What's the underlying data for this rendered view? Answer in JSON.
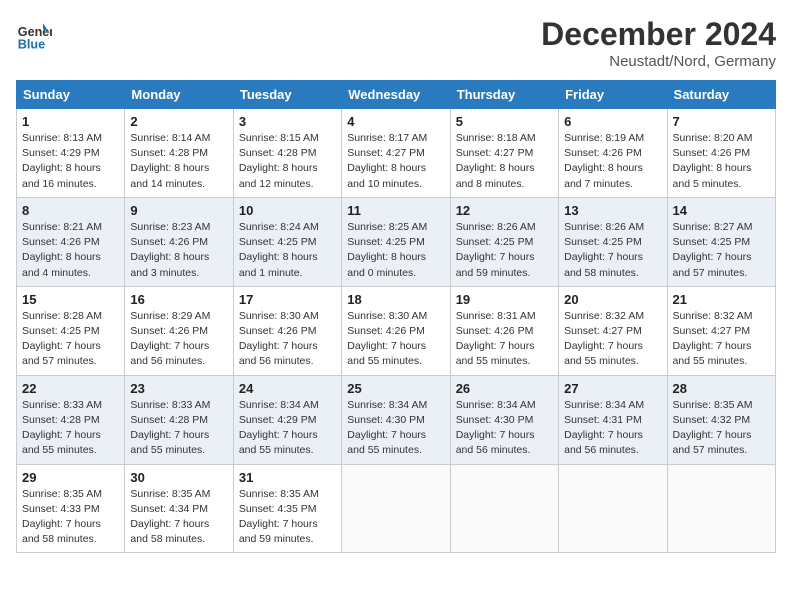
{
  "header": {
    "logo_line1": "General",
    "logo_line2": "Blue",
    "month": "December 2024",
    "location": "Neustadt/Nord, Germany"
  },
  "weekdays": [
    "Sunday",
    "Monday",
    "Tuesday",
    "Wednesday",
    "Thursday",
    "Friday",
    "Saturday"
  ],
  "weeks": [
    [
      {
        "day": "1",
        "sunrise": "8:13 AM",
        "sunset": "4:29 PM",
        "daylight": "8 hours and 16 minutes."
      },
      {
        "day": "2",
        "sunrise": "8:14 AM",
        "sunset": "4:28 PM",
        "daylight": "8 hours and 14 minutes."
      },
      {
        "day": "3",
        "sunrise": "8:15 AM",
        "sunset": "4:28 PM",
        "daylight": "8 hours and 12 minutes."
      },
      {
        "day": "4",
        "sunrise": "8:17 AM",
        "sunset": "4:27 PM",
        "daylight": "8 hours and 10 minutes."
      },
      {
        "day": "5",
        "sunrise": "8:18 AM",
        "sunset": "4:27 PM",
        "daylight": "8 hours and 8 minutes."
      },
      {
        "day": "6",
        "sunrise": "8:19 AM",
        "sunset": "4:26 PM",
        "daylight": "8 hours and 7 minutes."
      },
      {
        "day": "7",
        "sunrise": "8:20 AM",
        "sunset": "4:26 PM",
        "daylight": "8 hours and 5 minutes."
      }
    ],
    [
      {
        "day": "8",
        "sunrise": "8:21 AM",
        "sunset": "4:26 PM",
        "daylight": "8 hours and 4 minutes."
      },
      {
        "day": "9",
        "sunrise": "8:23 AM",
        "sunset": "4:26 PM",
        "daylight": "8 hours and 3 minutes."
      },
      {
        "day": "10",
        "sunrise": "8:24 AM",
        "sunset": "4:25 PM",
        "daylight": "8 hours and 1 minute."
      },
      {
        "day": "11",
        "sunrise": "8:25 AM",
        "sunset": "4:25 PM",
        "daylight": "8 hours and 0 minutes."
      },
      {
        "day": "12",
        "sunrise": "8:26 AM",
        "sunset": "4:25 PM",
        "daylight": "7 hours and 59 minutes."
      },
      {
        "day": "13",
        "sunrise": "8:26 AM",
        "sunset": "4:25 PM",
        "daylight": "7 hours and 58 minutes."
      },
      {
        "day": "14",
        "sunrise": "8:27 AM",
        "sunset": "4:25 PM",
        "daylight": "7 hours and 57 minutes."
      }
    ],
    [
      {
        "day": "15",
        "sunrise": "8:28 AM",
        "sunset": "4:25 PM",
        "daylight": "7 hours and 57 minutes."
      },
      {
        "day": "16",
        "sunrise": "8:29 AM",
        "sunset": "4:26 PM",
        "daylight": "7 hours and 56 minutes."
      },
      {
        "day": "17",
        "sunrise": "8:30 AM",
        "sunset": "4:26 PM",
        "daylight": "7 hours and 56 minutes."
      },
      {
        "day": "18",
        "sunrise": "8:30 AM",
        "sunset": "4:26 PM",
        "daylight": "7 hours and 55 minutes."
      },
      {
        "day": "19",
        "sunrise": "8:31 AM",
        "sunset": "4:26 PM",
        "daylight": "7 hours and 55 minutes."
      },
      {
        "day": "20",
        "sunrise": "8:32 AM",
        "sunset": "4:27 PM",
        "daylight": "7 hours and 55 minutes."
      },
      {
        "day": "21",
        "sunrise": "8:32 AM",
        "sunset": "4:27 PM",
        "daylight": "7 hours and 55 minutes."
      }
    ],
    [
      {
        "day": "22",
        "sunrise": "8:33 AM",
        "sunset": "4:28 PM",
        "daylight": "7 hours and 55 minutes."
      },
      {
        "day": "23",
        "sunrise": "8:33 AM",
        "sunset": "4:28 PM",
        "daylight": "7 hours and 55 minutes."
      },
      {
        "day": "24",
        "sunrise": "8:34 AM",
        "sunset": "4:29 PM",
        "daylight": "7 hours and 55 minutes."
      },
      {
        "day": "25",
        "sunrise": "8:34 AM",
        "sunset": "4:30 PM",
        "daylight": "7 hours and 55 minutes."
      },
      {
        "day": "26",
        "sunrise": "8:34 AM",
        "sunset": "4:30 PM",
        "daylight": "7 hours and 56 minutes."
      },
      {
        "day": "27",
        "sunrise": "8:34 AM",
        "sunset": "4:31 PM",
        "daylight": "7 hours and 56 minutes."
      },
      {
        "day": "28",
        "sunrise": "8:35 AM",
        "sunset": "4:32 PM",
        "daylight": "7 hours and 57 minutes."
      }
    ],
    [
      {
        "day": "29",
        "sunrise": "8:35 AM",
        "sunset": "4:33 PM",
        "daylight": "7 hours and 58 minutes."
      },
      {
        "day": "30",
        "sunrise": "8:35 AM",
        "sunset": "4:34 PM",
        "daylight": "7 hours and 58 minutes."
      },
      {
        "day": "31",
        "sunrise": "8:35 AM",
        "sunset": "4:35 PM",
        "daylight": "7 hours and 59 minutes."
      },
      null,
      null,
      null,
      null
    ]
  ]
}
